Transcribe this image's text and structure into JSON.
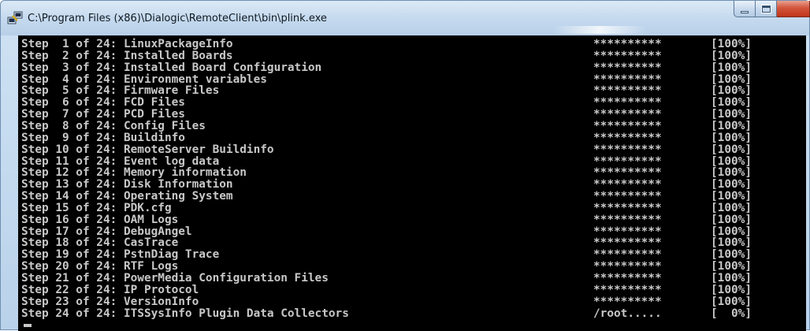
{
  "window": {
    "title": "C:\\Program Files (x86)\\Dialogic\\RemoteClient\\bin\\plink.exe",
    "icon": "putty-plink-icon"
  },
  "console": {
    "lines": [
      {
        "text": "Step  1 of 24: LinuxPackageInfo",
        "bar": "**********",
        "pct": "[100%]"
      },
      {
        "text": "Step  2 of 24: Installed Boards",
        "bar": "**********",
        "pct": "[100%]"
      },
      {
        "text": "Step  3 of 24: Installed Board Configuration",
        "bar": "**********",
        "pct": "[100%]"
      },
      {
        "text": "Step  4 of 24: Environment variables",
        "bar": "**********",
        "pct": "[100%]"
      },
      {
        "text": "Step  5 of 24: Firmware Files",
        "bar": "**********",
        "pct": "[100%]"
      },
      {
        "text": "Step  6 of 24: FCD Files",
        "bar": "**********",
        "pct": "[100%]"
      },
      {
        "text": "Step  7 of 24: PCD Files",
        "bar": "**********",
        "pct": "[100%]"
      },
      {
        "text": "Step  8 of 24: Config Files",
        "bar": "**********",
        "pct": "[100%]"
      },
      {
        "text": "Step  9 of 24: Buildinfo",
        "bar": "**********",
        "pct": "[100%]"
      },
      {
        "text": "Step 10 of 24: RemoteServer Buildinfo",
        "bar": "**********",
        "pct": "[100%]"
      },
      {
        "text": "Step 11 of 24: Event log data",
        "bar": "**********",
        "pct": "[100%]"
      },
      {
        "text": "Step 12 of 24: Memory information",
        "bar": "**********",
        "pct": "[100%]"
      },
      {
        "text": "Step 13 of 24: Disk Information",
        "bar": "**********",
        "pct": "[100%]"
      },
      {
        "text": "Step 14 of 24: Operating System",
        "bar": "**********",
        "pct": "[100%]"
      },
      {
        "text": "Step 15 of 24: PDK.cfg",
        "bar": "**********",
        "pct": "[100%]"
      },
      {
        "text": "Step 16 of 24: OAM Logs",
        "bar": "**********",
        "pct": "[100%]"
      },
      {
        "text": "Step 17 of 24: DebugAngel",
        "bar": "**********",
        "pct": "[100%]"
      },
      {
        "text": "Step 18 of 24: CasTrace",
        "bar": "**********",
        "pct": "[100%]"
      },
      {
        "text": "Step 19 of 24: PstnDiag Trace",
        "bar": "**********",
        "pct": "[100%]"
      },
      {
        "text": "Step 20 of 24: RTF Logs",
        "bar": "**********",
        "pct": "[100%]"
      },
      {
        "text": "Step 21 of 24: PowerMedia Configuration Files",
        "bar": "**********",
        "pct": "[100%]"
      },
      {
        "text": "Step 22 of 24: IP Protocol",
        "bar": "**********",
        "pct": "[100%]"
      },
      {
        "text": "Step 23 of 24: VersionInfo",
        "bar": "**********",
        "pct": "[100%]"
      },
      {
        "text": "Step 24 of 24: ITSSysInfo Plugin Data Collectors",
        "bar": "/root.....",
        "pct": "[  0%]"
      }
    ]
  },
  "colors": {
    "console_bg": "#000000",
    "console_fg": "#c8c8c8",
    "close_button": "#c0341a"
  }
}
